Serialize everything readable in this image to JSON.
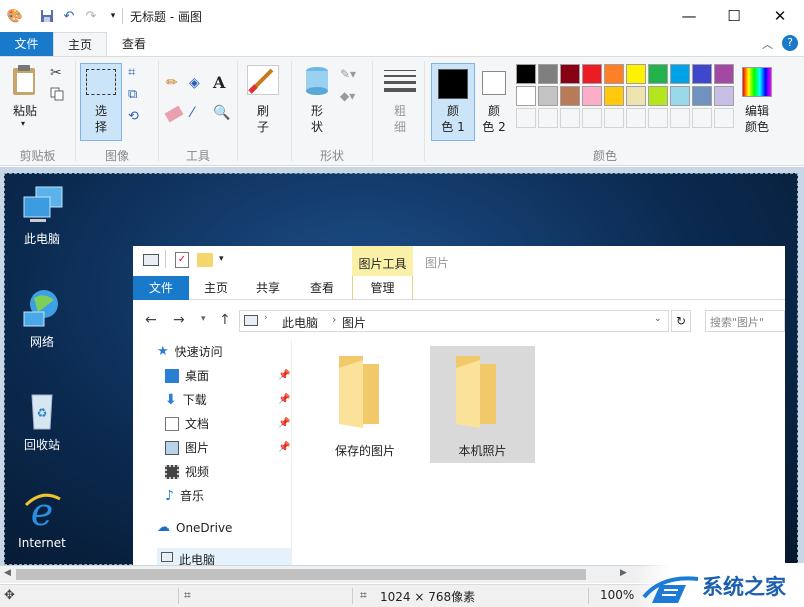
{
  "window": {
    "title": "无标题 - 画图"
  },
  "ribbon_tabs": {
    "file": "文件",
    "home": "主页",
    "view": "查看"
  },
  "ribbon": {
    "clipboard": {
      "paste": "粘贴",
      "group": "剪贴板"
    },
    "image": {
      "select_1": "选",
      "select_2": "择",
      "group": "图像"
    },
    "tools": {
      "group": "工具"
    },
    "brushes": {
      "label_1": "刷",
      "label_2": "子"
    },
    "shapes": {
      "label_1": "形",
      "label_2": "状",
      "group": "形状"
    },
    "size": {
      "label_1": "粗",
      "label_2": "细"
    },
    "color1": {
      "label_1": "颜",
      "label_2": "色 1"
    },
    "color2": {
      "label_1": "颜",
      "label_2": "色 2"
    },
    "edit_colors": {
      "label_1": "编辑",
      "label_2": "颜色"
    },
    "colors_group": "颜色",
    "palette_row1": [
      "#000000",
      "#7f7f7f",
      "#880015",
      "#ed1c24",
      "#ff7f27",
      "#fff200",
      "#22b14c",
      "#00a2e8",
      "#3f48cc",
      "#a349a4"
    ],
    "palette_row2": [
      "#ffffff",
      "#c3c3c3",
      "#b97a57",
      "#ffaec9",
      "#ffc90e",
      "#efe4b0",
      "#b5e61d",
      "#99d9ea",
      "#7092be",
      "#c8bfe7"
    ],
    "color1_value": "#000000",
    "color2_value": "#ffffff"
  },
  "desktop": {
    "icons": [
      "此电脑",
      "网络",
      "回收站",
      "Internet"
    ]
  },
  "explorer": {
    "context_tab": "图片工具",
    "window_title": "图片",
    "tabs": {
      "file": "文件",
      "home": "主页",
      "share": "共享",
      "view": "查看",
      "manage": "管理"
    },
    "path": [
      "此电脑",
      "图片"
    ],
    "search_placeholder": "搜索\"图片\"",
    "nav": {
      "quick_access": "快速访问",
      "desktop": "桌面",
      "downloads": "下载",
      "documents": "文档",
      "pictures": "图片",
      "videos": "视频",
      "music": "音乐",
      "onedrive": "OneDrive",
      "this_pc": "此电脑"
    },
    "folders": [
      "保存的图片",
      "本机照片"
    ]
  },
  "status": {
    "dimensions": "1024 × 768像素",
    "zoom": "100%"
  },
  "watermark": {
    "text": "系统之家"
  }
}
